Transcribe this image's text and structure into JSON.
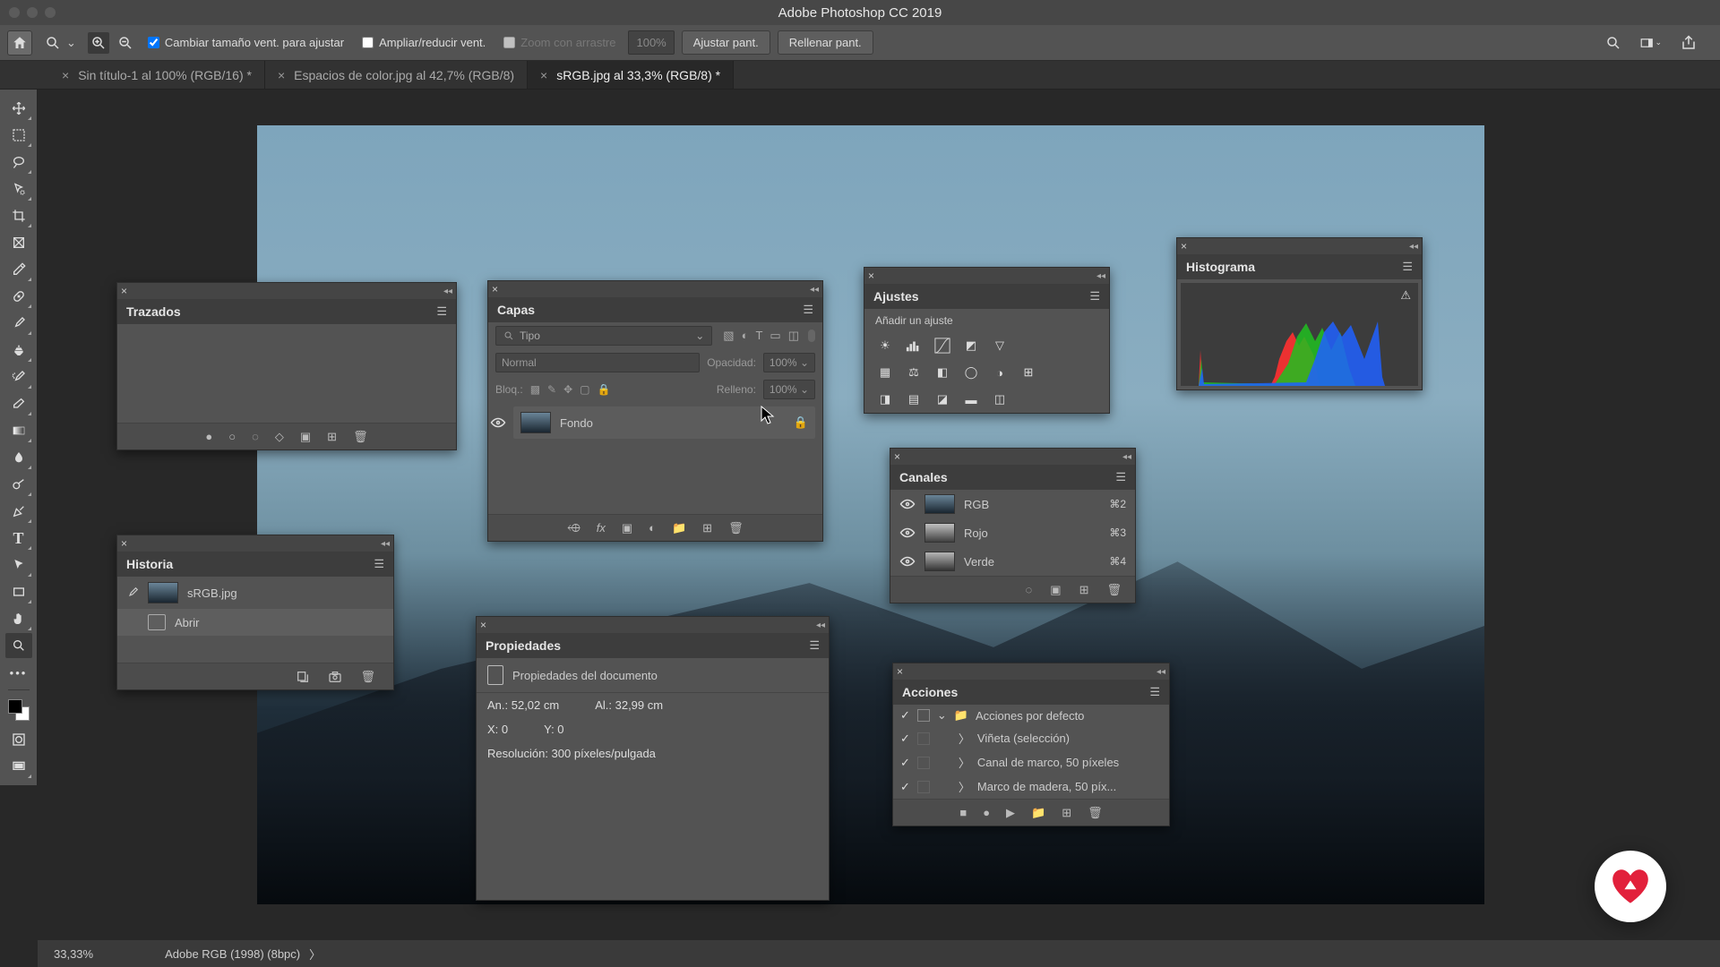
{
  "app_title": "Adobe Photoshop CC 2019",
  "options": {
    "resize_chk": "Cambiar tamaño vent. para ajustar",
    "zoom_chk": "Ampliar/reducir vent.",
    "scrubby": "Zoom con arrastre",
    "zoom_val": "100%",
    "fit_btn": "Ajustar pant.",
    "fill_btn": "Rellenar pant."
  },
  "tabs": [
    {
      "label": "Sin título-1 al 100% (RGB/16) *",
      "active": false
    },
    {
      "label": "Espacios de color.jpg al 42,7% (RGB/8)",
      "active": false
    },
    {
      "label": "sRGB.jpg al 33,3% (RGB/8) *",
      "active": true
    }
  ],
  "panels": {
    "trazados": {
      "title": "Trazados"
    },
    "historia": {
      "title": "Historia",
      "doc": "sRGB.jpg",
      "items": [
        "Abrir"
      ]
    },
    "capas": {
      "title": "Capas",
      "kind": "Tipo",
      "blend": "Normal",
      "opacity_lbl": "Opacidad:",
      "opacity_val": "100%",
      "lock_lbl": "Bloq.:",
      "fill_lbl": "Relleno:",
      "fill_val": "100%",
      "layer": "Fondo"
    },
    "propiedades": {
      "title": "Propiedades",
      "subtitle": "Propiedades del documento",
      "width": "An.: 52,02 cm",
      "height": "Al.: 32,99 cm",
      "x": "X: 0",
      "y": "Y: 0",
      "res": "Resolución: 300 píxeles/pulgada"
    },
    "ajustes": {
      "title": "Ajustes",
      "subtitle": "Añadir un ajuste"
    },
    "canales": {
      "title": "Canales",
      "items": [
        {
          "name": "RGB",
          "key": "⌘2",
          "grad": "linear-gradient(#6a8598,#1a2630)"
        },
        {
          "name": "Rojo",
          "key": "⌘3",
          "grad": "linear-gradient(#c0c0c0,#404040)"
        },
        {
          "name": "Verde",
          "key": "⌘4",
          "grad": "linear-gradient(#b5b5b5,#353535)"
        }
      ]
    },
    "acciones": {
      "title": "Acciones",
      "items": [
        {
          "label": "Acciones por defecto",
          "folder": true
        },
        {
          "label": "Viñeta (selección)"
        },
        {
          "label": "Canal de marco, 50 píxeles"
        },
        {
          "label": "Marco de madera, 50 píx..."
        }
      ]
    },
    "histograma": {
      "title": "Histograma"
    }
  },
  "status": {
    "zoom": "33,33%",
    "info": "Adobe RGB (1998) (8bpc)"
  }
}
